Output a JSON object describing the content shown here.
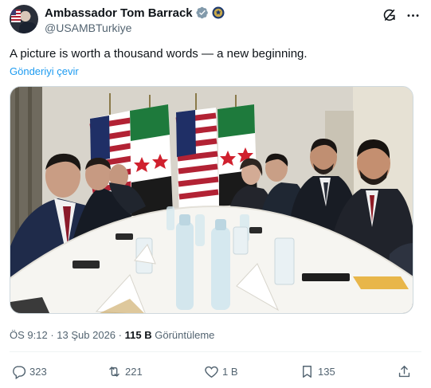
{
  "author": {
    "display_name": "Ambassador Tom Barrack",
    "handle": "@USAMBTurkiye",
    "avatar_icon": "avatar",
    "verified_icon": "government-verified-badge-icon",
    "affiliation_icon": "us-seal-icon"
  },
  "header_actions": [
    "grok-icon",
    "more-icon"
  ],
  "tweet": {
    "text": "A picture is worth a thousand words — a new beginning.",
    "translate_label": "Gönderiyi çevir"
  },
  "media": {
    "alt": "",
    "content_icon": "photo"
  },
  "meta": {
    "time": "ÖS 9:12",
    "separator": "·",
    "date": "13 Şub 2026",
    "views_count": "115 B",
    "views_label": "Görüntüleme"
  },
  "actions": {
    "reply_count": "323",
    "retweet_count": "221",
    "like_count": "1 B",
    "bookmark_count": "135"
  },
  "colors": {
    "link": "#1d9bf0",
    "secondary_text": "#536471",
    "primary_text": "#0f1419",
    "verified_gray": "#829aab"
  }
}
